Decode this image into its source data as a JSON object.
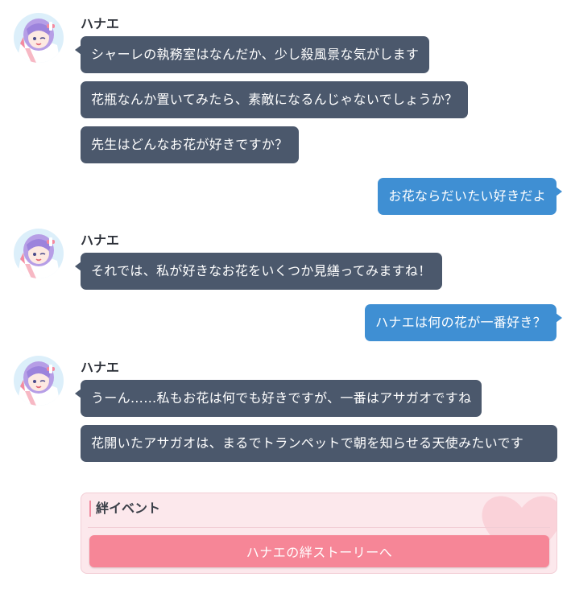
{
  "sender_name": "ハナエ",
  "groups": [
    {
      "messages": [
        "シャーレの執務室はなんだか、少し殺風景な気がします",
        "花瓶なんか置いてみたら、素敵になるんじゃないでしょうか？",
        "先生はどんなお花が好きですか？"
      ]
    },
    {
      "messages": [
        "それでは、私が好きなお花をいくつか見繕ってみますね！"
      ]
    },
    {
      "messages": [
        "うーん……私もお花は何でも好きですが、一番はアサガオですね",
        "花開いたアサガオは、まるでトランペットで朝を知らせる天使みたいです"
      ]
    }
  ],
  "replies": [
    "お花ならだいたい好きだよ",
    "ハナエは何の花が一番好き？"
  ],
  "kizuna": {
    "title": "絆イベント",
    "button_label": "ハナエの絆ストーリーへ"
  },
  "icons": {
    "avatar": "nurse-girl-avatar-icon",
    "heart": "heart-icon"
  },
  "colors": {
    "npc_bubble": "#4b586c",
    "player_bubble": "#3f8fd3",
    "kizuna_bg": "#fce8ec",
    "kizuna_button": "#f68697"
  }
}
